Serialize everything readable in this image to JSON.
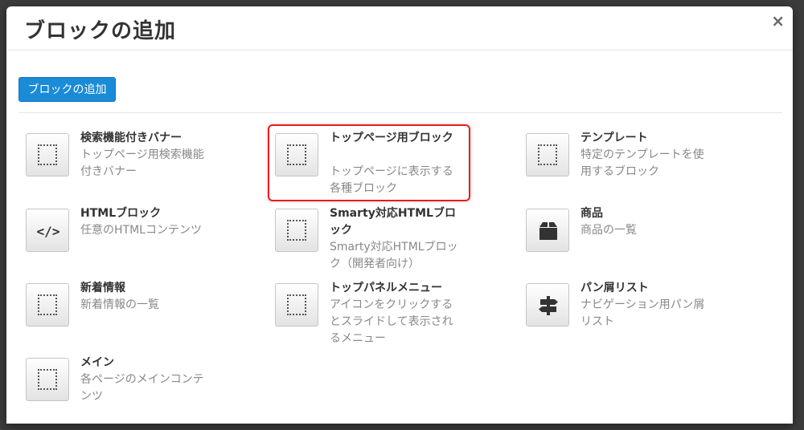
{
  "modal": {
    "title": "ブロックの追加",
    "close_label": "×",
    "add_button_label": "ブロックの追加"
  },
  "blocks": [
    {
      "title": "検索機能付きバナー",
      "description": "トップページ用検索機能付きバナー",
      "icon": "dotted-square-icon"
    },
    {
      "title": "トップページ用ブロック",
      "description": "トップページに表示する各種ブロック",
      "icon": "dotted-square-icon"
    },
    {
      "title": "テンプレート",
      "description": "特定のテンプレートを使用するブロック",
      "icon": "dotted-square-icon"
    },
    {
      "title": "HTMLブロック",
      "description": "任意のHTMLコンテンツ",
      "icon": "code-icon"
    },
    {
      "title": "Smarty対応HTMLブロック",
      "description": "Smarty対応HTMLブロック（開発者向け）",
      "icon": "dotted-square-icon"
    },
    {
      "title": "商品",
      "description": "商品の一覧",
      "icon": "box-icon"
    },
    {
      "title": "新着情報",
      "description": "新着情報の一覧",
      "icon": "dotted-square-icon"
    },
    {
      "title": "トップパネルメニュー",
      "description": "アイコンをクリックするとスライドして表示されるメニュー",
      "icon": "dotted-square-icon"
    },
    {
      "title": "パン屑リスト",
      "description": "ナビゲーション用パン屑リスト",
      "icon": "signpost-icon"
    },
    {
      "title": "メイン",
      "description": "各ページのメインコンテンツ",
      "icon": "dotted-square-icon"
    }
  ],
  "colors": {
    "primary_button": "#1a8bd6",
    "highlight_border": "#e02020",
    "title_text": "#333333",
    "description_text": "#888888"
  }
}
